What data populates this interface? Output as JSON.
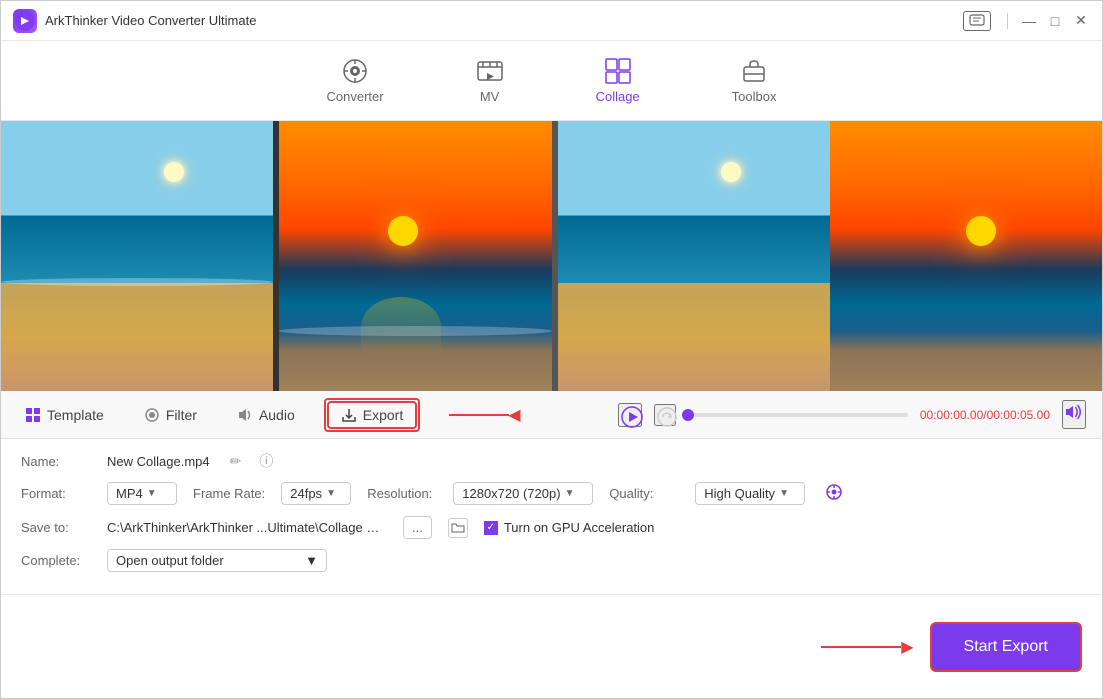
{
  "app": {
    "title": "ArkThinker Video Converter Ultimate",
    "icon_bg": "#7c3aed"
  },
  "titlebar": {
    "chat_icon": "⊡",
    "minimize": "—",
    "maximize": "□",
    "close": "✕"
  },
  "nav": {
    "items": [
      {
        "id": "converter",
        "label": "Converter",
        "active": false
      },
      {
        "id": "mv",
        "label": "MV",
        "active": false
      },
      {
        "id": "collage",
        "label": "Collage",
        "active": true
      },
      {
        "id": "toolbox",
        "label": "Toolbox",
        "active": false
      }
    ]
  },
  "toolbar": {
    "template_label": "Template",
    "filter_label": "Filter",
    "audio_label": "Audio",
    "export_label": "Export"
  },
  "playback": {
    "time_current": "00:00:00.00",
    "time_total": "00:00:05.00",
    "separator": "/"
  },
  "export_panel": {
    "name_label": "Name:",
    "name_value": "New Collage.mp4",
    "format_label": "Format:",
    "format_value": "MP4",
    "frame_rate_label": "Frame Rate:",
    "frame_rate_value": "24fps",
    "resolution_label": "Resolution:",
    "resolution_value": "1280x720 (720p)",
    "quality_label": "Quality:",
    "quality_value": "High Quality",
    "save_to_label": "Save to:",
    "save_to_path": "C:\\ArkThinker\\ArkThinker ...Ultimate\\Collage Exported",
    "browse_label": "...",
    "gpu_label": "Turn on GPU Acceleration",
    "complete_label": "Complete:",
    "complete_value": "Open output folder"
  },
  "actions": {
    "start_export_label": "Start Export"
  }
}
